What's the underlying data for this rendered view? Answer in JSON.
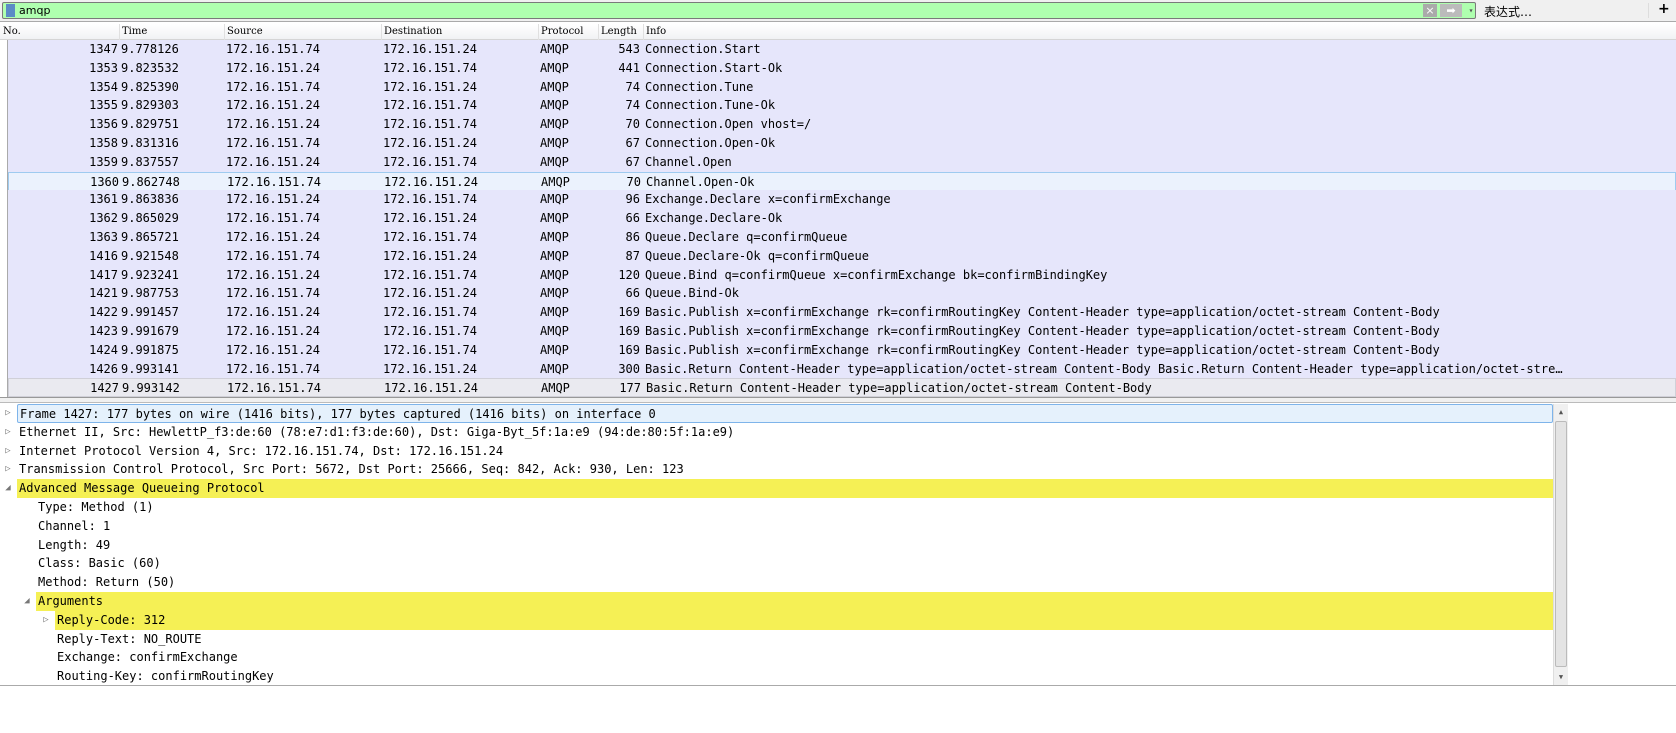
{
  "filter": {
    "value": "amqp",
    "clear_icon": "×",
    "apply_icon": "➡",
    "dropdown_icon": "▾",
    "expression_label": "表达式…",
    "add_label": "+"
  },
  "columns": [
    "No.",
    "Time",
    "Source",
    "Destination",
    "Protocol",
    "Length",
    "Info"
  ],
  "packets": [
    {
      "no": "1347",
      "time": "9.778126",
      "src": "172.16.151.74",
      "dst": "172.16.151.24",
      "proto": "AMQP",
      "len": "543",
      "info": "Connection.Start"
    },
    {
      "no": "1353",
      "time": "9.823532",
      "src": "172.16.151.24",
      "dst": "172.16.151.74",
      "proto": "AMQP",
      "len": "441",
      "info": "Connection.Start-Ok"
    },
    {
      "no": "1354",
      "time": "9.825390",
      "src": "172.16.151.74",
      "dst": "172.16.151.24",
      "proto": "AMQP",
      "len": "74",
      "info": "Connection.Tune"
    },
    {
      "no": "1355",
      "time": "9.829303",
      "src": "172.16.151.24",
      "dst": "172.16.151.74",
      "proto": "AMQP",
      "len": "74",
      "info": "Connection.Tune-Ok"
    },
    {
      "no": "1356",
      "time": "9.829751",
      "src": "172.16.151.24",
      "dst": "172.16.151.74",
      "proto": "AMQP",
      "len": "70",
      "info": "Connection.Open vhost=/"
    },
    {
      "no": "1358",
      "time": "9.831316",
      "src": "172.16.151.74",
      "dst": "172.16.151.24",
      "proto": "AMQP",
      "len": "67",
      "info": "Connection.Open-Ok"
    },
    {
      "no": "1359",
      "time": "9.837557",
      "src": "172.16.151.24",
      "dst": "172.16.151.74",
      "proto": "AMQP",
      "len": "67",
      "info": "Channel.Open"
    },
    {
      "no": "1360",
      "time": "9.862748",
      "src": "172.16.151.74",
      "dst": "172.16.151.24",
      "proto": "AMQP",
      "len": "70",
      "info": "Channel.Open-Ok"
    },
    {
      "no": "1361",
      "time": "9.863836",
      "src": "172.16.151.24",
      "dst": "172.16.151.74",
      "proto": "AMQP",
      "len": "96",
      "info": "Exchange.Declare x=confirmExchange"
    },
    {
      "no": "1362",
      "time": "9.865029",
      "src": "172.16.151.74",
      "dst": "172.16.151.24",
      "proto": "AMQP",
      "len": "66",
      "info": "Exchange.Declare-Ok"
    },
    {
      "no": "1363",
      "time": "9.865721",
      "src": "172.16.151.24",
      "dst": "172.16.151.74",
      "proto": "AMQP",
      "len": "86",
      "info": "Queue.Declare q=confirmQueue"
    },
    {
      "no": "1416",
      "time": "9.921548",
      "src": "172.16.151.74",
      "dst": "172.16.151.24",
      "proto": "AMQP",
      "len": "87",
      "info": "Queue.Declare-Ok q=confirmQueue"
    },
    {
      "no": "1417",
      "time": "9.923241",
      "src": "172.16.151.24",
      "dst": "172.16.151.74",
      "proto": "AMQP",
      "len": "120",
      "info": "Queue.Bind q=confirmQueue x=confirmExchange bk=confirmBindingKey"
    },
    {
      "no": "1421",
      "time": "9.987753",
      "src": "172.16.151.74",
      "dst": "172.16.151.24",
      "proto": "AMQP",
      "len": "66",
      "info": "Queue.Bind-Ok"
    },
    {
      "no": "1422",
      "time": "9.991457",
      "src": "172.16.151.24",
      "dst": "172.16.151.74",
      "proto": "AMQP",
      "len": "169",
      "info": "Basic.Publish x=confirmExchange rk=confirmRoutingKey Content-Header type=application/octet-stream Content-Body"
    },
    {
      "no": "1423",
      "time": "9.991679",
      "src": "172.16.151.24",
      "dst": "172.16.151.74",
      "proto": "AMQP",
      "len": "169",
      "info": "Basic.Publish x=confirmExchange rk=confirmRoutingKey Content-Header type=application/octet-stream Content-Body"
    },
    {
      "no": "1424",
      "time": "9.991875",
      "src": "172.16.151.24",
      "dst": "172.16.151.74",
      "proto": "AMQP",
      "len": "169",
      "info": "Basic.Publish x=confirmExchange rk=confirmRoutingKey Content-Header type=application/octet-stream Content-Body"
    },
    {
      "no": "1426",
      "time": "9.993141",
      "src": "172.16.151.74",
      "dst": "172.16.151.24",
      "proto": "AMQP",
      "len": "300",
      "info": "Basic.Return Content-Header type=application/octet-stream Content-Body Basic.Return Content-Header type=application/octet-stream Content-Body"
    },
    {
      "no": "1427",
      "time": "9.993142",
      "src": "172.16.151.74",
      "dst": "172.16.151.24",
      "proto": "AMQP",
      "len": "177",
      "info": "Basic.Return Content-Header type=application/octet-stream Content-Body"
    }
  ],
  "details": [
    {
      "text": "Frame 1427: 177 bytes on wire (1416 bits), 177 bytes captured (1416 bits) on interface 0",
      "level": 0,
      "tw": "▷",
      "style": "frame"
    },
    {
      "text": "Ethernet II, Src: HewlettP_f3:de:60 (78:e7:d1:f3:de:60), Dst: Giga-Byt_5f:1a:e9 (94:de:80:5f:1a:e9)",
      "level": 0,
      "tw": "▷",
      "style": ""
    },
    {
      "text": "Internet Protocol Version 4, Src: 172.16.151.74, Dst: 172.16.151.24",
      "level": 0,
      "tw": "▷",
      "style": ""
    },
    {
      "text": "Transmission Control Protocol, Src Port: 5672, Dst Port: 25666, Seq: 842, Ack: 930, Len: 123",
      "level": 0,
      "tw": "▷",
      "style": ""
    },
    {
      "text": "Advanced Message Queueing Protocol",
      "level": 0,
      "tw": "◢",
      "style": "hl"
    },
    {
      "text": "Type: Method (1)",
      "level": 1,
      "tw": "",
      "style": ""
    },
    {
      "text": "Channel: 1",
      "level": 1,
      "tw": "",
      "style": ""
    },
    {
      "text": "Length: 49",
      "level": 1,
      "tw": "",
      "style": ""
    },
    {
      "text": "Class: Basic (60)",
      "level": 1,
      "tw": "",
      "style": ""
    },
    {
      "text": "Method: Return (50)",
      "level": 1,
      "tw": "",
      "style": ""
    },
    {
      "text": "Arguments",
      "level": 1,
      "tw": "◢",
      "style": "hl"
    },
    {
      "text": "Reply-Code: 312",
      "level": 2,
      "tw": "▷",
      "style": "hl"
    },
    {
      "text": "Reply-Text: NO_ROUTE",
      "level": 2,
      "tw": "",
      "style": ""
    },
    {
      "text": "Exchange: confirmExchange",
      "level": 2,
      "tw": "",
      "style": ""
    },
    {
      "text": "Routing-Key: confirmRoutingKey",
      "level": 2,
      "tw": "",
      "style": ""
    }
  ],
  "scrollbar": {
    "up_icon": "▲",
    "down_icon": "▼"
  }
}
